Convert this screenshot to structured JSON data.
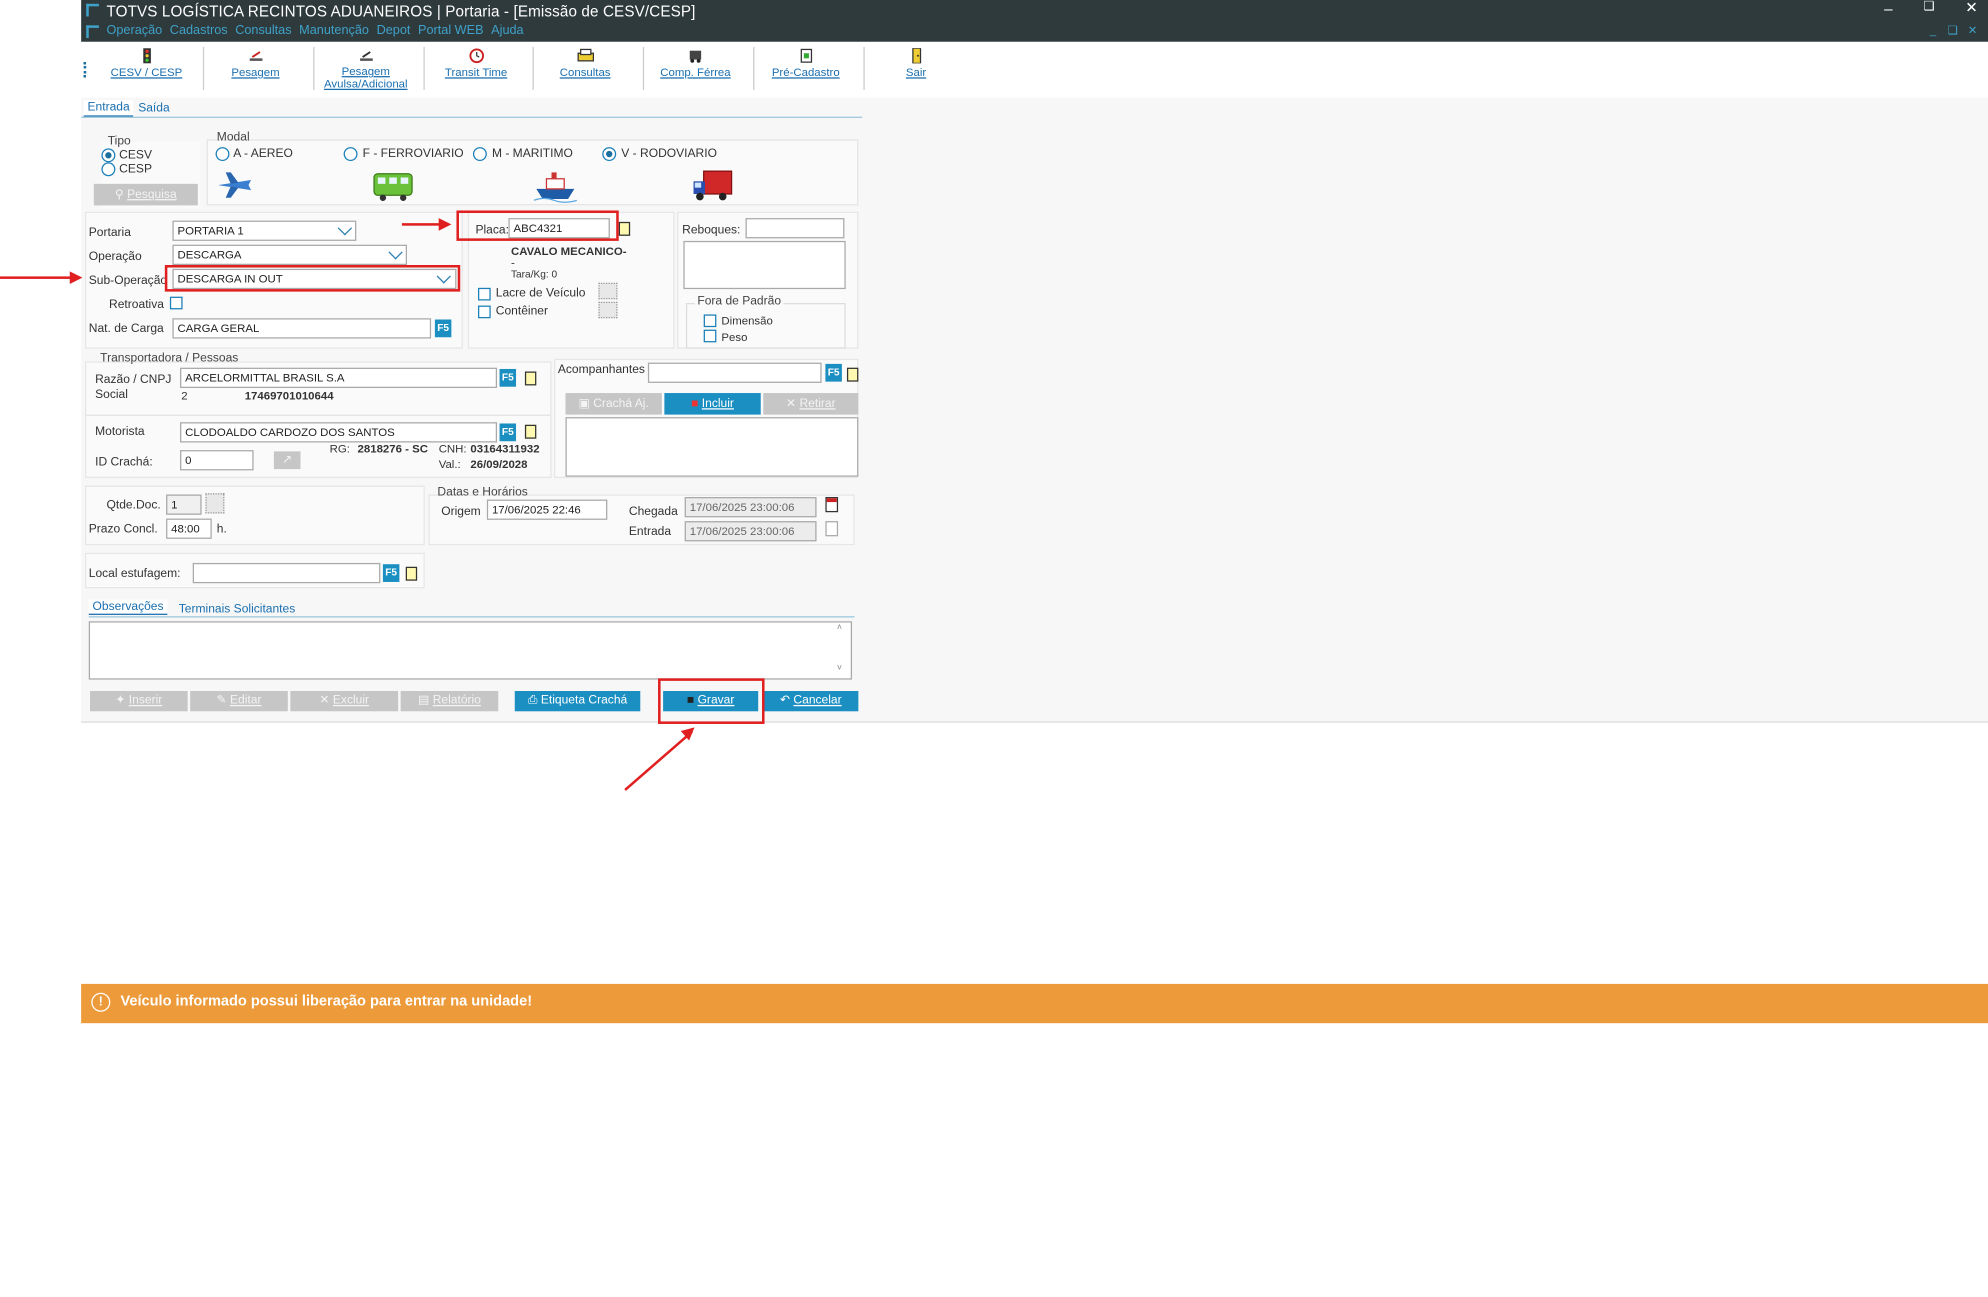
{
  "window": {
    "title": "TOTVS LOGÍSTICA RECINTOS ADUANEIROS | Portaria - [Emissão de CESV/CESP]",
    "menu": [
      "Operação",
      "Cadastros",
      "Consultas",
      "Manutenção",
      "Depot",
      "Portal WEB",
      "Ajuda"
    ]
  },
  "toolbar": [
    {
      "label": "CESV / CESP",
      "icon": "traffic-light-icon"
    },
    {
      "label": "Pesagem",
      "icon": "scale-icon"
    },
    {
      "label": "Pesagem Avulsa/Adicional",
      "icon": "scale-icon"
    },
    {
      "label": "Transit Time",
      "icon": "clock-icon"
    },
    {
      "label": "Consultas",
      "icon": "printer-icon"
    },
    {
      "label": "Comp. Férrea",
      "icon": "train-icon"
    },
    {
      "label": "Pré-Cadastro",
      "icon": "register-icon"
    },
    {
      "label": "Sair",
      "icon": "exit-door-icon"
    }
  ],
  "tabs": {
    "entrada": "Entrada",
    "saida": "Saída"
  },
  "tipo": {
    "title": "Tipo",
    "cesv": "CESV",
    "cesp": "CESP",
    "pesquisa": "Pesquisa"
  },
  "modal": {
    "title": "Modal",
    "aereo": "A - AEREO",
    "ferroviario": "F - FERROVIARIO",
    "maritimo": "M - MARITIMO",
    "rodoviario": "V - RODOVIARIO"
  },
  "form": {
    "portaria_label": "Portaria",
    "portaria_value": "PORTARIA 1",
    "operacao_label": "Operação",
    "operacao_value": "DESCARGA",
    "suboperacao_label": "Sub-Operação",
    "suboperacao_value": "DESCARGA IN OUT",
    "retroativa_label": "Retroativa",
    "natcarga_label": "Nat. de Carga",
    "natcarga_value": "CARGA GERAL",
    "f5": "F5"
  },
  "veiculo": {
    "placa_label": "Placa:",
    "placa_value": "ABC4321",
    "tipo": "CAVALO MECANICO-",
    "tipo2": "-",
    "tara": "Tara/Kg: 0",
    "lacre": "Lacre de Veículo",
    "conteiner": "Contêiner",
    "reboques_label": "Reboques:",
    "fora_padrao": "Fora de Padrão",
    "dimensao": "Dimensão",
    "peso": "Peso"
  },
  "transportadora": {
    "title": "Transportadora / Pessoas",
    "razao_label": "Razão / CNPJ",
    "social_label": "Social",
    "razao_value": "ARCELORMITTAL BRASIL S.A",
    "num": "2",
    "cnpj": "17469701010644",
    "motorista_label": "Motorista",
    "motorista_value": "CLODOALDO CARDOZO DOS SANTOS",
    "idcracha_label": "ID Crachá:",
    "idcracha_value": "0",
    "rg_label": "RG:",
    "rg_value": "2818276 - SC",
    "cnh_label": "CNH:",
    "cnh_value": "03164311932",
    "val_label": "Val.:",
    "val_value": "26/09/2028"
  },
  "acompanhantes": {
    "title": "Acompanhantes",
    "cracha": "Crachá Aj.",
    "incluir": "Incluir",
    "retirar": "Retirar"
  },
  "docs": {
    "qtde_label": "Qtde.Doc.",
    "qtde_value": "1",
    "prazo_label": "Prazo Concl.",
    "prazo_value": "48:00",
    "prazo_unit": "h."
  },
  "datas": {
    "title": "Datas e Horários",
    "origem_label": "Origem",
    "origem_value": "17/06/2025 22:46",
    "chegada_label": "Chegada",
    "chegada_value": "17/06/2025 23:00:06",
    "entrada_label": "Entrada",
    "entrada_value": "17/06/2025 23:00:06"
  },
  "local": {
    "label": "Local estufagem:"
  },
  "obs_tabs": {
    "observacoes": "Observações",
    "terminais": "Terminais Solicitantes"
  },
  "actions": {
    "inserir": "Inserir",
    "editar": "Editar",
    "excluir": "Excluir",
    "relatorio": "Relatório",
    "etiqueta": "Etiqueta Crachá",
    "gravar": "Gravar",
    "cancelar": "Cancelar"
  },
  "banner": {
    "message": "Veículo informado possui liberação para entrar na unidade!"
  }
}
